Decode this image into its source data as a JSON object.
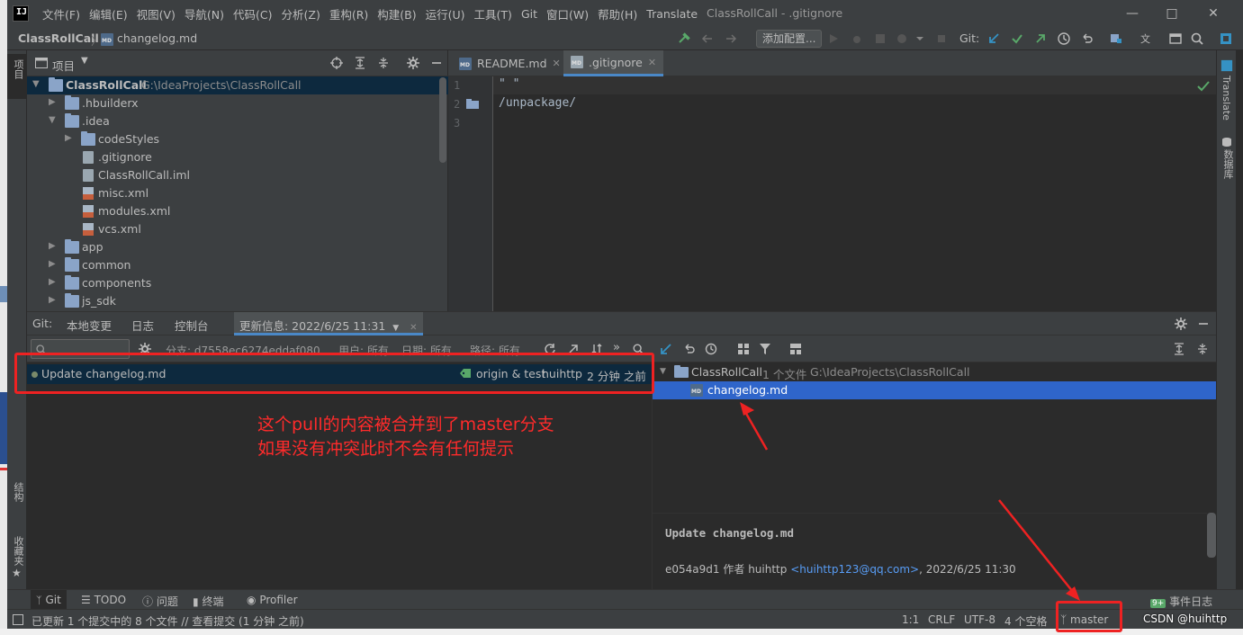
{
  "app": {
    "menu": [
      "文件(F)",
      "编辑(E)",
      "视图(V)",
      "导航(N)",
      "代码(C)",
      "分析(Z)",
      "重构(R)",
      "构建(B)",
      "运行(U)",
      "工具(T)",
      "Git",
      "窗口(W)",
      "帮助(H)",
      "Translate"
    ],
    "window_title": "ClassRollCall - .gitignore"
  },
  "navbar": {
    "project": "ClassRollCall",
    "file": "changelog.md",
    "add_config": "添加配置...",
    "git_label": "Git:"
  },
  "project_panel": {
    "title": "项目",
    "tree": [
      {
        "label": "ClassRollCall",
        "path": "G:\\IdeaProjects\\ClassRollCall"
      },
      {
        "label": ".hbuilderx"
      },
      {
        "label": ".idea"
      },
      {
        "label": "codeStyles"
      },
      {
        "label": ".gitignore"
      },
      {
        "label": "ClassRollCall.iml"
      },
      {
        "label": "misc.xml"
      },
      {
        "label": "modules.xml"
      },
      {
        "label": "vcs.xml"
      },
      {
        "label": "app"
      },
      {
        "label": "common"
      },
      {
        "label": "components"
      },
      {
        "label": "js_sdk"
      }
    ]
  },
  "editor": {
    "tabs": [
      {
        "label": "README.md"
      },
      {
        "label": ".gitignore"
      }
    ],
    "lines": [
      {
        "num": "1",
        "code": "\" \""
      },
      {
        "num": "2",
        "code": "/unpackage/"
      },
      {
        "num": "3",
        "code": ""
      }
    ]
  },
  "right_strip": {
    "translate": "Translate",
    "database": "数据库"
  },
  "left_strip": {
    "project": "项目",
    "structure": "结构",
    "favorites": "收藏夹"
  },
  "git_panel": {
    "tabs": [
      "Git:",
      "本地变更",
      "日志",
      "控制台",
      "更新信息: 2022/6/25 11:31"
    ],
    "filters": {
      "branch": "分支: d7558ec6274eddaf080...",
      "user": "用户: 所有",
      "date": "日期: 所有",
      "path": "路径: 所有"
    },
    "commit": {
      "message": "Update changelog.md",
      "refs": "origin & test",
      "author": "huihttp",
      "time": "2 分钟 之前"
    },
    "changes": {
      "root": "ClassRollCall",
      "count": "1 个文件",
      "path": "G:\\IdeaProjects\\ClassRollCall",
      "file": "changelog.md"
    },
    "details": {
      "subject": "Update changelog.md",
      "hash": "e054a9d1",
      "by": "作者",
      "author": "huihttp",
      "email": "<huihttp123@qq.com>",
      "date": ", 2022/6/25 11:30"
    }
  },
  "annotation": {
    "line1": "这个pull的内容被合并到了master分支",
    "line2": "如果没有冲突此时不会有任何提示"
  },
  "bottom_tools": [
    "Git",
    "TODO",
    "问题",
    "终端",
    "Profiler"
  ],
  "event_log": {
    "badge": "9+",
    "label": "事件日志"
  },
  "status_bar": {
    "message": "已更新 1 个提交中的 8 个文件 // 查看提交 (1 分钟 之前)",
    "position": "1:1",
    "line_sep": "CRLF",
    "encoding": "UTF-8",
    "indent": "4 个空格",
    "branch": "master"
  },
  "watermark": "CSDN @huihttp",
  "colors": {
    "accent": "#4a88c7",
    "selection": "#2f65ca",
    "annotation_red": "#ee2222"
  }
}
